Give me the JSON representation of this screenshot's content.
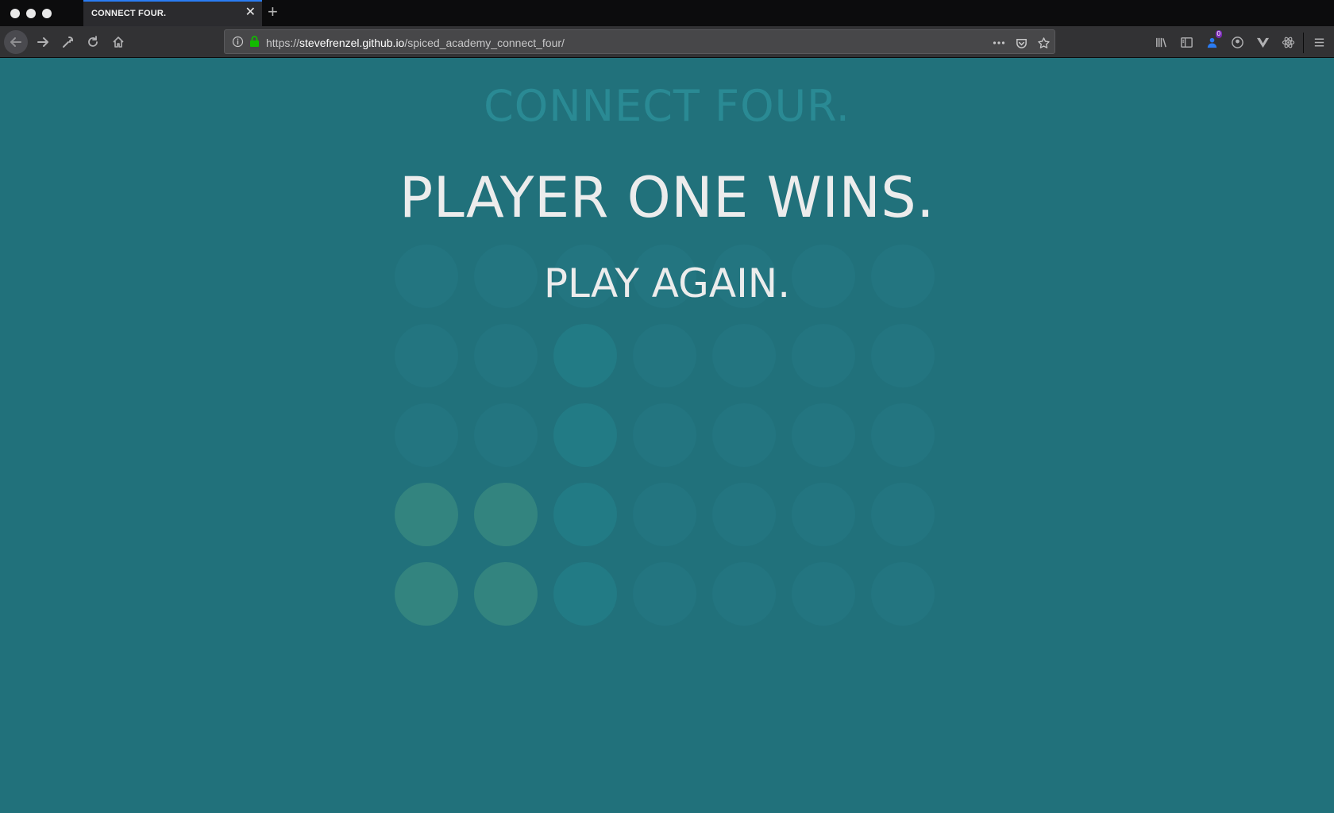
{
  "browser": {
    "tab_title": "CONNECT FOUR.",
    "new_tab_label": "+",
    "close_label": "✕",
    "url_scheme": "https://",
    "url_host": "stevefrenzel.github.io",
    "url_path": "/spiced_academy_connect_four/",
    "extension_badge": "0",
    "accent_color": "#2a7cf4"
  },
  "game": {
    "title": "CONNECT FOUR.",
    "result": "PLAYER ONE WINS.",
    "play_again": "PLAY AGAIN.",
    "columns": 7,
    "rows": 5,
    "board": [
      [
        "empty",
        "empty",
        "empty",
        "empty",
        "empty",
        "empty",
        "empty"
      ],
      [
        "empty",
        "empty",
        "p2",
        "empty",
        "empty",
        "empty",
        "empty"
      ],
      [
        "empty",
        "empty",
        "p2",
        "empty",
        "empty",
        "empty",
        "empty"
      ],
      [
        "p1",
        "p1",
        "p2",
        "empty",
        "empty",
        "empty",
        "empty"
      ],
      [
        "p1",
        "p1",
        "p2",
        "empty",
        "empty",
        "empty",
        "empty"
      ]
    ],
    "colors": {
      "background": "#21717b",
      "empty_slot": "#237580",
      "player_one": "#33847f",
      "player_two": "#227b85",
      "text": "#ececec",
      "title": "#2a8a94"
    }
  }
}
